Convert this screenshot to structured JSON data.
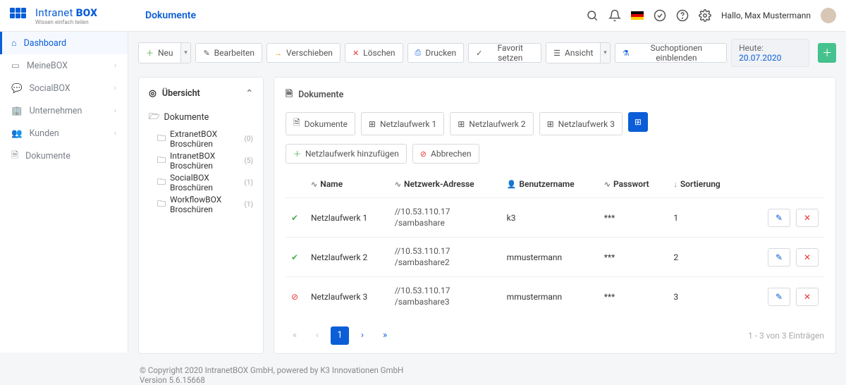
{
  "header": {
    "brand_main": "Intranet",
    "brand_sub": "BOX",
    "brand_tag": "Wissen einfach teilen",
    "page_title": "Dokumente",
    "greeting": "Hallo,",
    "user": "Max Mustermann",
    "today_label": "Heute:",
    "today_date": "20.07.2020"
  },
  "sidebar": {
    "items": [
      {
        "label": "Dashboard",
        "icon": "home",
        "active": true,
        "expandable": false
      },
      {
        "label": "MeineBOX",
        "icon": "box",
        "active": false,
        "expandable": true
      },
      {
        "label": "SocialBOX",
        "icon": "chat",
        "active": false,
        "expandable": true
      },
      {
        "label": "Unternehmen",
        "icon": "building",
        "active": false,
        "expandable": true
      },
      {
        "label": "Kunden",
        "icon": "people",
        "active": false,
        "expandable": true
      },
      {
        "label": "Dokumente",
        "icon": "doc",
        "active": false,
        "expandable": false
      }
    ]
  },
  "toolbar": {
    "new": "Neu",
    "edit": "Bearbeiten",
    "move": "Verschieben",
    "delete": "Löschen",
    "print": "Drucken",
    "favorite": "Favorit setzen",
    "view": "Ansicht",
    "search_opts": "Suchoptionen einblenden"
  },
  "overview": {
    "title": "Übersicht",
    "root": "Dokumente",
    "children": [
      {
        "label": "ExtranetBOX Broschüren",
        "count": "(0)"
      },
      {
        "label": "IntranetBOX Broschüren",
        "count": "(5)"
      },
      {
        "label": "SocialBOX Broschüren",
        "count": "(1)"
      },
      {
        "label": "WorkflowBOX Broschüren",
        "count": "(1)"
      }
    ]
  },
  "content": {
    "title": "Dokumente",
    "tabs": [
      {
        "label": "Dokumente",
        "icon": "doc"
      },
      {
        "label": "Netzlaufwerk 1",
        "icon": "grid"
      },
      {
        "label": "Netzlaufwerk 2",
        "icon": "grid"
      },
      {
        "label": "Netzlaufwerk 3",
        "icon": "grid"
      }
    ],
    "add_drive": "Netzlaufwerk hinzufügen",
    "cancel": "Abbrechen",
    "columns": {
      "name": "Name",
      "addr": "Netzwerk-Adresse",
      "user": "Benutzername",
      "pass": "Passwort",
      "sort": "Sortierung"
    },
    "rows": [
      {
        "status": "ok",
        "name": "Netzlaufwerk 1",
        "addr1": "//10.53.110.17",
        "addr2": "/sambashare",
        "user": "k3",
        "pass": "***",
        "sort": "1"
      },
      {
        "status": "ok",
        "name": "Netzlaufwerk 2",
        "addr1": "//10.53.110.17",
        "addr2": "/sambashare2",
        "user": "mmustermann",
        "pass": "***",
        "sort": "2"
      },
      {
        "status": "err",
        "name": "Netzlaufwerk 3",
        "addr1": "//10.53.110.17",
        "addr2": "/sambashare3",
        "user": "mmustermann",
        "pass": "***",
        "sort": "3"
      }
    ],
    "page_current": "1",
    "page_info": "1 - 3 von 3 Einträgen"
  },
  "footer": {
    "copyright": "© Copyright 2020 IntranetBOX GmbH, powered by K3 Innovationen GmbH",
    "version": "Version 5.6.15668"
  }
}
